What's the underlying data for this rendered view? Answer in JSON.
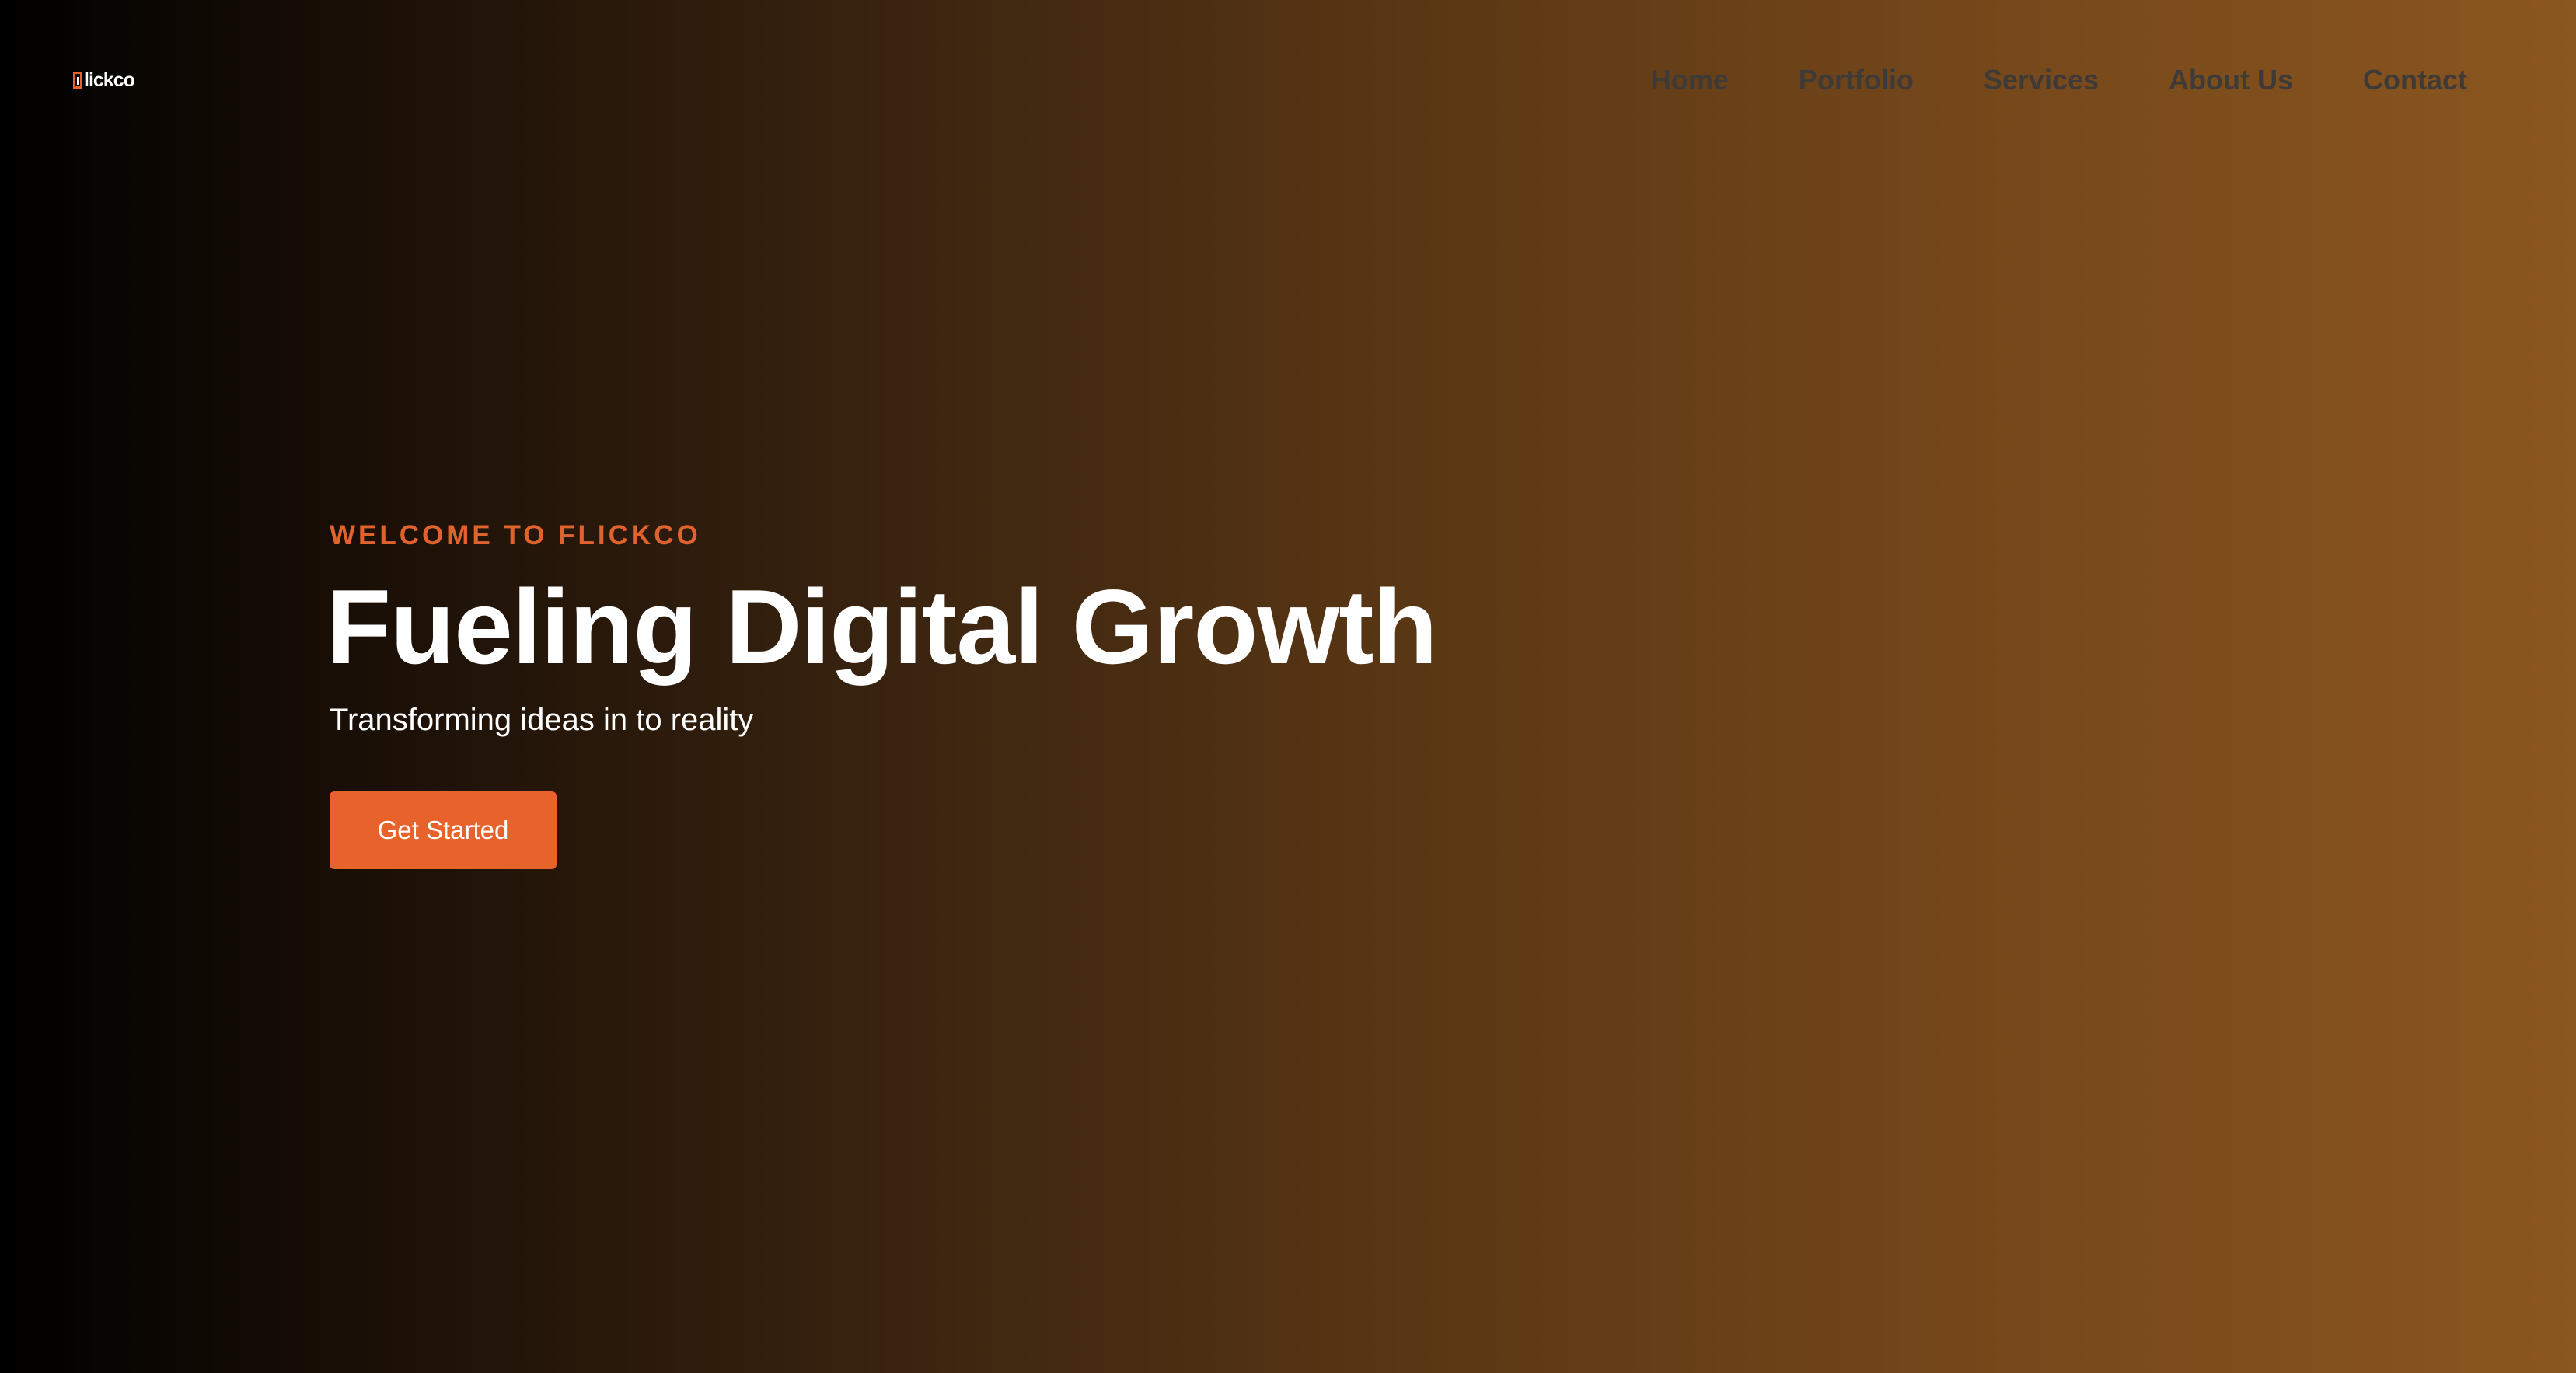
{
  "brand": {
    "logo_text": "lickco",
    "accent_color": "#e8622c"
  },
  "nav": {
    "items": [
      {
        "label": "Home"
      },
      {
        "label": "Portfolio"
      },
      {
        "label": "Services"
      },
      {
        "label": "About Us"
      },
      {
        "label": "Contact"
      }
    ]
  },
  "hero": {
    "eyebrow": "WELCOME TO FLICKCO",
    "headline": "Fueling Digital Growth",
    "subhead": "Transforming ideas in to reality",
    "cta_label": "Get Started"
  }
}
